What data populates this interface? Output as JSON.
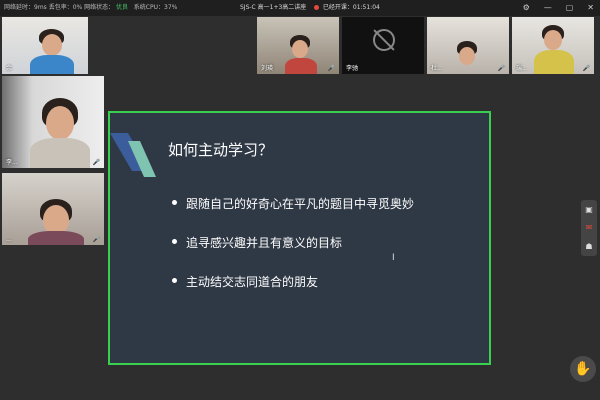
{
  "topbar": {
    "network": "网络延时：9ms 丢包率：0% 网络状态：",
    "network_status": "优良",
    "cpu": "系统CPU：37%",
    "title": "SJS-C 高一1+3高二讲座",
    "record": "已经开课：01:51:04"
  },
  "participants": {
    "top": [
      {
        "name": "余"
      },
      {
        "name": "刘瑛"
      },
      {
        "name": "李驰"
      },
      {
        "name": "杜..."
      },
      {
        "name": "瑞..."
      }
    ],
    "left": [
      {
        "name": "李..."
      },
      {
        "name": "..."
      }
    ]
  },
  "slide": {
    "title": "如何主动学习？",
    "bullets": [
      "跟随自己的好奇心在平凡的题目中寻觅奥妙",
      "追寻感兴趣并且有意义的目标",
      "主动结交志同道合的朋友"
    ]
  },
  "icons": {
    "settings": "gear-icon",
    "minimize": "minimize-icon",
    "maximize": "maximize-icon",
    "close": "close-icon",
    "raise_hand": "hand-icon"
  }
}
